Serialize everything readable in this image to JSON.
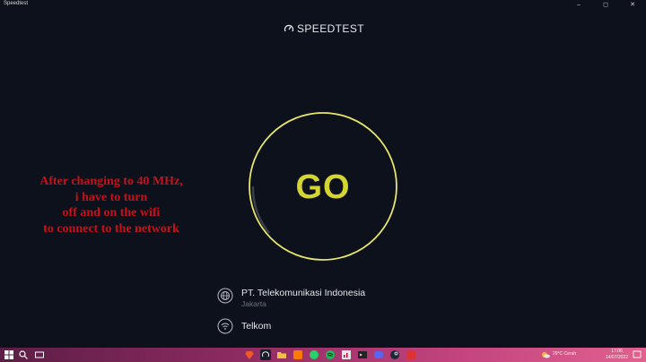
{
  "window": {
    "title": "Speedtest"
  },
  "brand": {
    "logo": "speedometer-icon",
    "name": "SPEEDTEST"
  },
  "go_button": {
    "label": "GO"
  },
  "annotation": {
    "lines": [
      "After changing to 40 MHz,",
      "i have to turn",
      "off and on the wifi",
      "to connect to the network"
    ]
  },
  "server": {
    "icon": "globe-icon",
    "name": "PT. Telekomunikasi Indonesia",
    "location": "Jakarta"
  },
  "provider": {
    "icon": "wifi-icon",
    "name": "Telkom"
  },
  "taskbar": {
    "weather": "29°C  Cerah",
    "time": "17:06",
    "date": "14/07/2022"
  },
  "colors": {
    "background": "#0d111b",
    "accent": "#d4d432",
    "annotation": "#c8101a"
  }
}
